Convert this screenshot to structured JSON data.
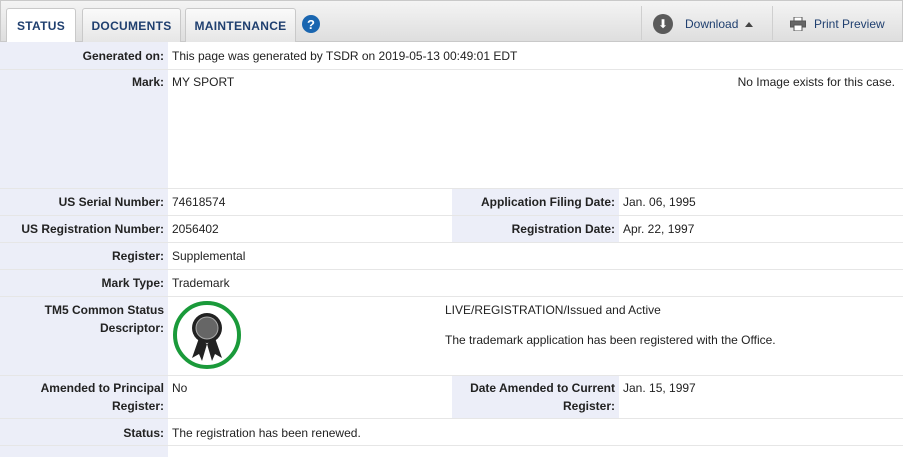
{
  "tabs": [
    {
      "label": "STATUS"
    },
    {
      "label": "DOCUMENTS"
    },
    {
      "label": "MAINTENANCE"
    }
  ],
  "toolbar": {
    "help_symbol": "?",
    "download_label": "Download",
    "print_label": "Print Preview"
  },
  "fields": {
    "generated_on": {
      "label": "Generated on:",
      "value": "This page was generated by TSDR on 2019-05-13 00:49:01 EDT"
    },
    "mark": {
      "label": "Mark:",
      "value": "MY SPORT",
      "image_note": "No Image exists for this case."
    },
    "serial": {
      "label": "US Serial Number:",
      "value": "74618574"
    },
    "filing_date": {
      "label": "Application Filing Date:",
      "value": "Jan. 06, 1995"
    },
    "registration_number": {
      "label": "US Registration Number:",
      "value": "2056402"
    },
    "registration_date": {
      "label": "Registration Date:",
      "value": "Apr. 22, 1997"
    },
    "register": {
      "label": "Register:",
      "value": "Supplemental"
    },
    "mark_type": {
      "label": "Mark Type:",
      "value": "Trademark"
    },
    "tm5": {
      "label_line1": "TM5 Common Status",
      "label_line2": "Descriptor:",
      "status": "LIVE/REGISTRATION/Issued and Active",
      "description": "The trademark application has been registered with the Office."
    },
    "amended_principal": {
      "label_line1": "Amended to Principal",
      "label_line2": "Register:",
      "value": "No"
    },
    "amended_current": {
      "label_line1": "Date Amended to Current",
      "label_line2": "Register:",
      "value": "Jan. 15, 1997"
    },
    "status": {
      "label": "Status:",
      "value": "The registration has been renewed."
    }
  },
  "colors": {
    "tab_text": "#1f3f6f",
    "label_bg": "#eceef8",
    "badge_ring": "#1a9a3a",
    "help_icon": "#1a66b0"
  }
}
